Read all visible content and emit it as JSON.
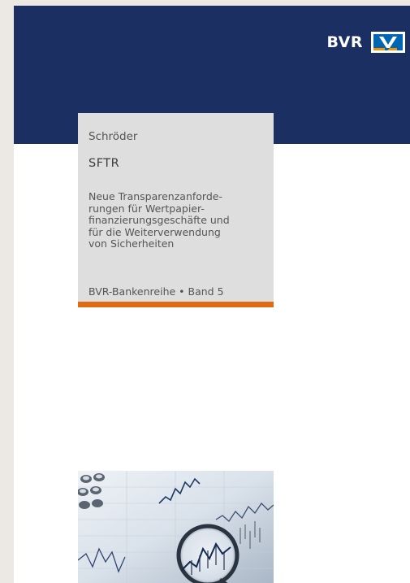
{
  "publisher": {
    "brand_text": "BVR",
    "logo_icon": "volksbank-raiffeisenbank-logo-icon",
    "colors": {
      "band": "#1b2f63",
      "logo_blue": "#0066b3",
      "logo_orange": "#f39200"
    }
  },
  "book": {
    "author": "Schröder",
    "title": "SFTR",
    "subtitle_lines": [
      "Neue Transparenzanforde-",
      "rungen für Wertpapier-",
      "finanzierungsgeschäfte und",
      "für die Weiterverwendung",
      "von Sicherheiten"
    ],
    "series": "BVR-Bankenreihe • Band 5",
    "accent_color": "#dd6b12"
  },
  "cover_image": {
    "description_icon": "magnifying-glass-over-stock-charts-icon"
  }
}
